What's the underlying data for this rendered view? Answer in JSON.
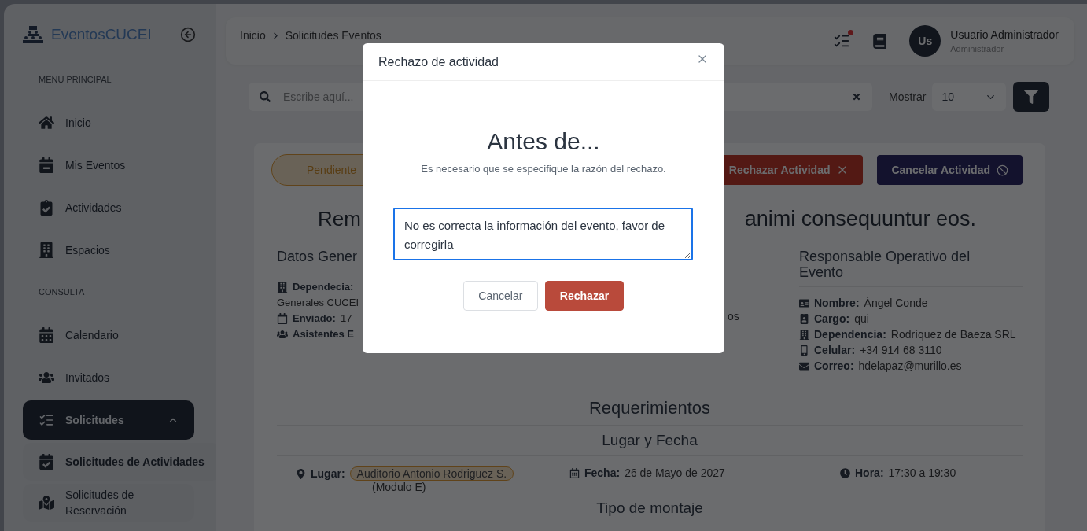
{
  "sidebar": {
    "brand": "EventosCUCEI",
    "sections": [
      {
        "title": "MENU PRINCIPAL",
        "items": [
          {
            "label": "Inicio",
            "selected": false
          },
          {
            "label": "Mis Eventos",
            "selected": false
          },
          {
            "label": "Actividades",
            "selected": false
          },
          {
            "label": "Espacios",
            "selected": false
          }
        ]
      },
      {
        "title": "CONSULTA",
        "items": [
          {
            "label": "Calendario",
            "selected": false
          },
          {
            "label": "Invitados",
            "selected": false
          },
          {
            "label": "Solicitudes",
            "selected": true,
            "expanded": true,
            "children": [
              {
                "label": "Solicitudes de Actividades",
                "selected": true
              },
              {
                "label": "Solicitudes de Reservación",
                "selected": false
              }
            ]
          }
        ]
      }
    ]
  },
  "breadcrumb": [
    "Inicio",
    "Solicitudes Eventos"
  ],
  "user": {
    "initials": "Us",
    "name": "Usuario Administrador",
    "role": "Administrador"
  },
  "search": {
    "placeholder": "Escribe aquí..."
  },
  "page_size": {
    "label": "Mostrar",
    "value": "10"
  },
  "detail": {
    "status": "Pendiente",
    "actions": [
      {
        "label": "Rechazar Actividad",
        "kind": "reject"
      },
      {
        "label": "Cancelar Actividad",
        "kind": "cancel"
      }
    ],
    "title_fragments": [
      "Rem",
      "animi consequuntur eos."
    ],
    "general": {
      "heading": "Datos Gener",
      "rows": [
        {
          "label": "Dependecia:",
          "value": "Generales CUCEI"
        },
        {
          "label": "Enviado:",
          "value": "17"
        },
        {
          "label": "Asistentes E"
        }
      ]
    },
    "middle_fragment": "os",
    "responsible": {
      "heading": "Responsable Operativo del Evento",
      "rows": [
        {
          "label": "Nombre:",
          "value": "Ángel Conde"
        },
        {
          "label": "Cargo:",
          "value": "qui"
        },
        {
          "label": "Dependencia:",
          "value": "Rodríquez de Baeza SRL"
        },
        {
          "label": "Celular:",
          "value": "+34 914 68 3110"
        },
        {
          "label": "Correo:",
          "value": "hdelapaz@murillo.es"
        }
      ]
    },
    "requirements": {
      "heading": "Requerimientos",
      "subheading": "Lugar y Fecha",
      "place": {
        "label": "Lugar:",
        "value": "Auditorio Antonio Rodriguez S.",
        "note": "(Modulo E)"
      },
      "date": {
        "label": "Fecha:",
        "value": "26 de Mayo de 2027"
      },
      "time": {
        "label": "Hora:",
        "value": "17:30 a 19:30"
      },
      "next_heading": "Tipo de montaje"
    }
  },
  "modal": {
    "title": "Rechazo de actividad",
    "heading": "Antes de...",
    "message": "Es necesario que se especifique la razón del rechazo.",
    "reason": "No es correcta la información del evento, favor de corregirla",
    "buttons": [
      {
        "label": "Cancelar",
        "kind": "secondary"
      },
      {
        "label": "Rechazar",
        "kind": "danger"
      }
    ]
  }
}
